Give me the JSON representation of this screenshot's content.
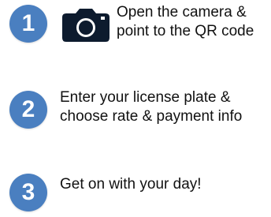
{
  "steps": [
    {
      "number": "1",
      "line1": "Open the camera &",
      "line2": "point to the QR code",
      "icon": "camera-icon"
    },
    {
      "number": "2",
      "line1": "Enter your license plate &",
      "line2": "choose rate & payment info"
    },
    {
      "number": "3",
      "line1": "Get on with your day!"
    }
  ],
  "colors": {
    "badge": "#4a7fc0",
    "camera": "#0d1b2e",
    "text": "#111111"
  }
}
